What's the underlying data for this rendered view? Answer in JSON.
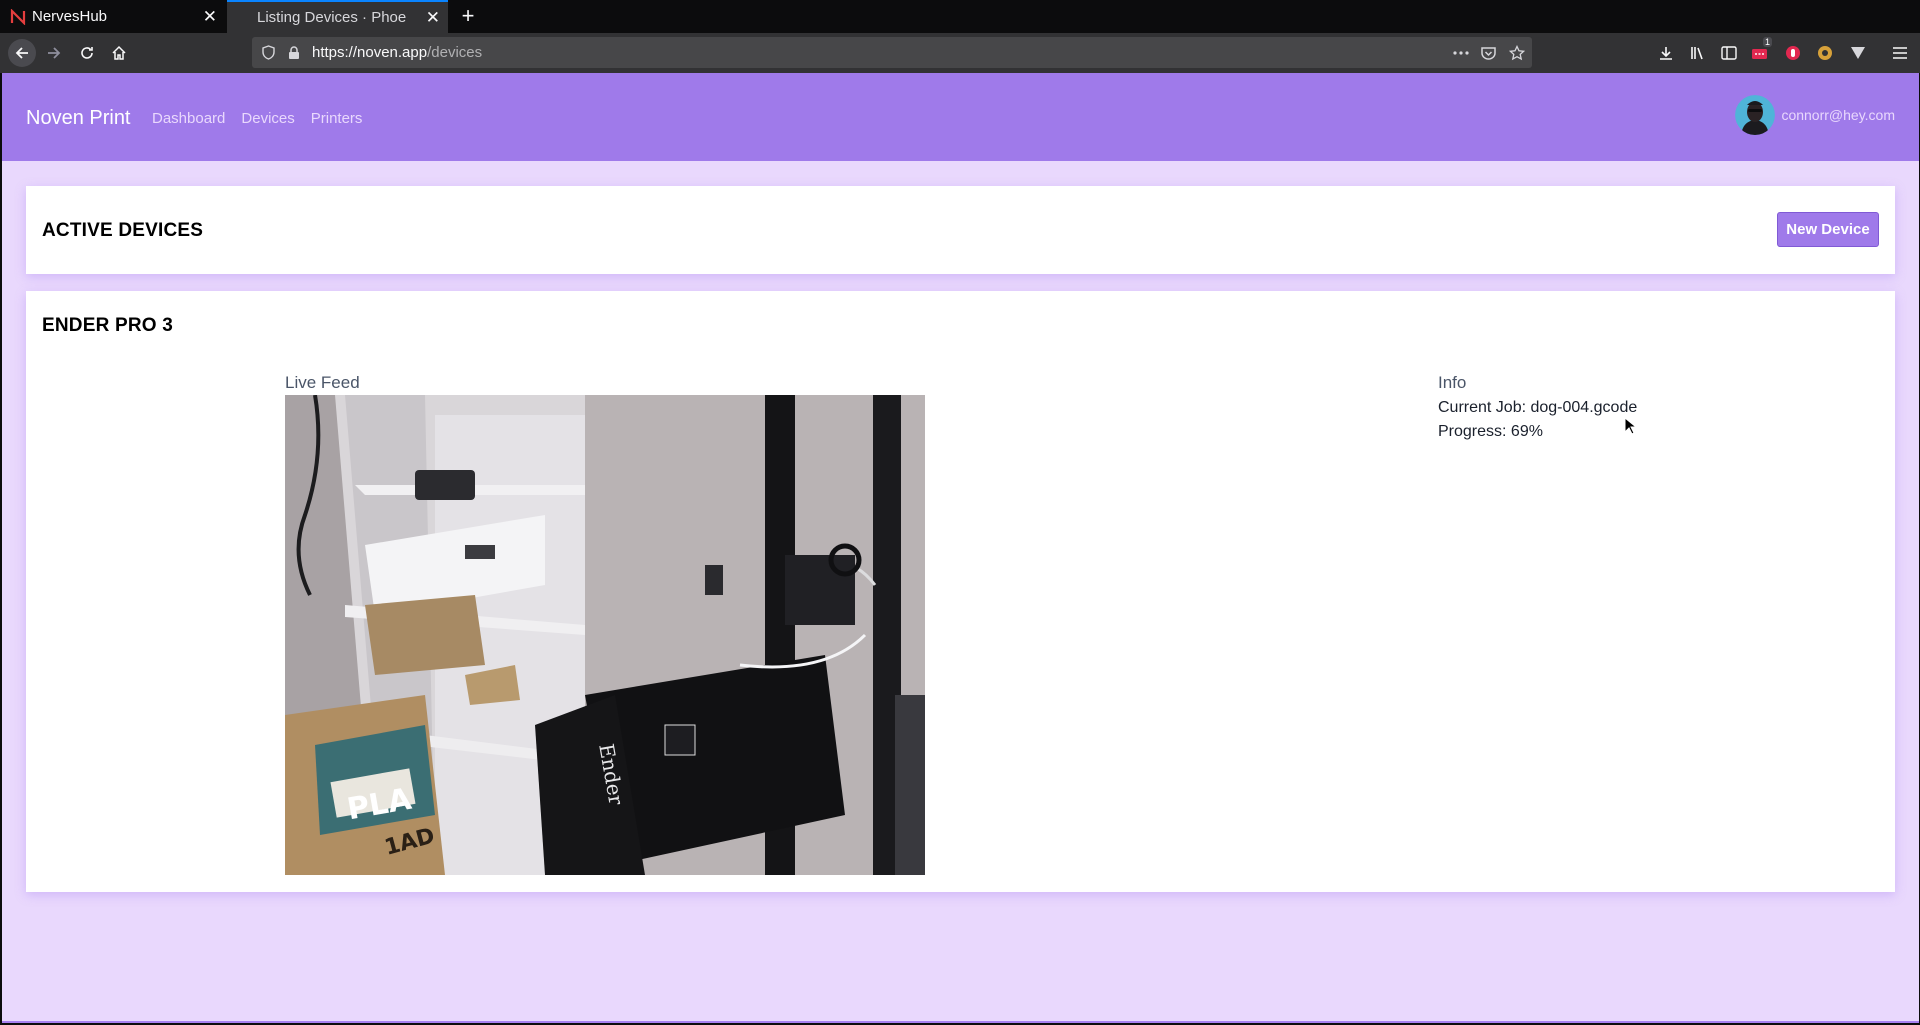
{
  "browser": {
    "tabs": [
      {
        "title": "NervesHub",
        "active": false
      },
      {
        "title": "Listing Devices · Phoenix",
        "active": true
      }
    ],
    "url_host": "https://noven.app",
    "url_path": "/devices",
    "downloads_badge": "1"
  },
  "header": {
    "brand": "Noven Print",
    "nav": [
      "Dashboard",
      "Devices",
      "Printers"
    ],
    "user_email": "connorr@hey.com"
  },
  "active_devices": {
    "title": "ACTIVE DEVICES",
    "new_device_label": "New Device"
  },
  "device": {
    "name": "ENDER PRO 3",
    "feed_label": "Live Feed",
    "info_label": "Info",
    "current_job": "Current Job: dog-004.gcode",
    "progress": "Progress: 69%",
    "feed_caption_printer": "Ender",
    "feed_caption_box": "PLA",
    "feed_caption_box2": "1AD"
  },
  "colors": {
    "accent": "#9f7aea",
    "background": "#e9d8fd"
  }
}
